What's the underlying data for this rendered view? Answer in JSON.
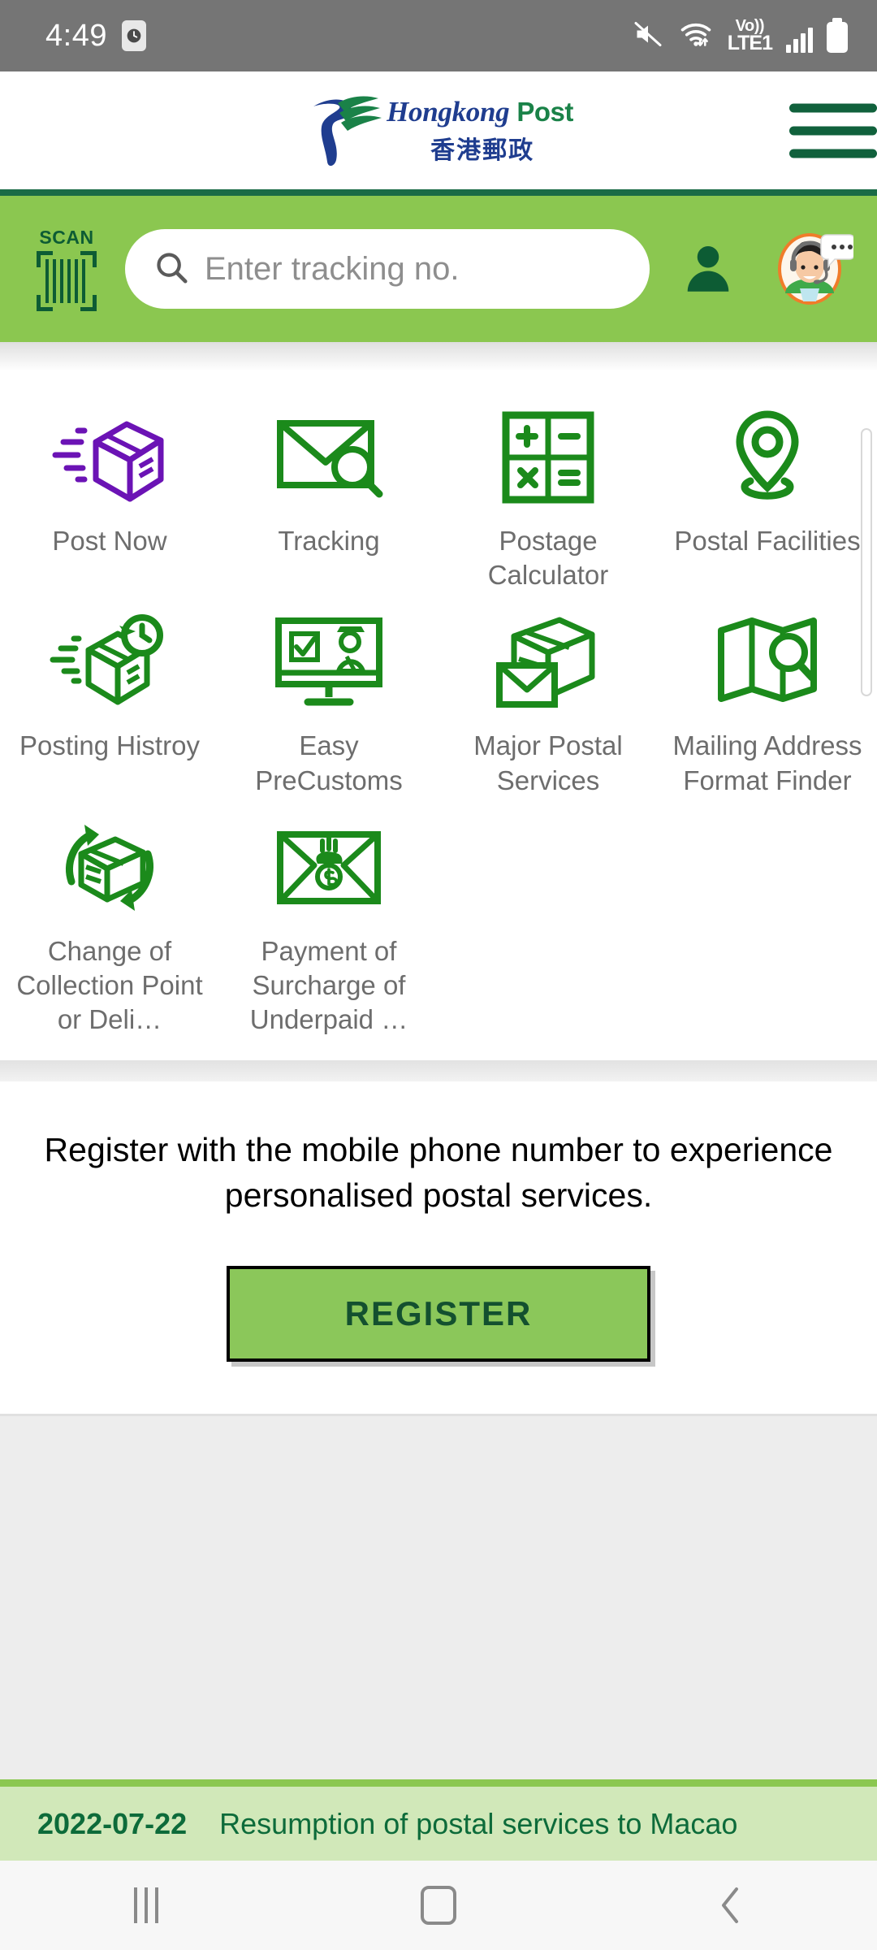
{
  "status_bar": {
    "time": "4:49",
    "clock_icon": "clock-icon",
    "icons": [
      "mute-icon",
      "wifi-icon",
      "volte-icon",
      "signal-icon",
      "battery-icon"
    ],
    "volte_top": "Vo))",
    "volte_bottom": "LTE1"
  },
  "header": {
    "logo_name_en": "Hongkong",
    "logo_name_post": "Post",
    "logo_name_zh": "香港郵政",
    "menu_icon": "hamburger-menu-icon"
  },
  "search": {
    "scan_label": "SCAN",
    "scan_icon": "barcode-scan-icon",
    "placeholder": "Enter tracking no.",
    "search_icon": "search-icon",
    "account_icon": "person-icon",
    "support_icon": "customer-service-avatar-icon"
  },
  "services": [
    {
      "label": "Post Now",
      "icon": "parcel-speed-icon",
      "color": "#6b13b5"
    },
    {
      "label": "Tracking",
      "icon": "envelope-search-icon",
      "color": "#1b8a1b"
    },
    {
      "label": "Postage Calculator",
      "icon": "calculator-icon",
      "color": "#1b8a1b"
    },
    {
      "label": "Postal Facilities",
      "icon": "location-pin-icon",
      "color": "#1b8a1b"
    },
    {
      "label": "Posting Histroy",
      "icon": "parcel-clock-icon",
      "color": "#1b8a1b"
    },
    {
      "label": "Easy PreCustoms",
      "icon": "monitor-customs-officer-icon",
      "color": "#1b8a1b"
    },
    {
      "label": "Major Postal Services",
      "icon": "parcel-envelope-icon",
      "color": "#1b8a1b"
    },
    {
      "label": "Mailing Address Format Finder",
      "icon": "map-search-icon",
      "color": "#1b8a1b"
    },
    {
      "label": "Change of Collection Point or Deli…",
      "icon": "parcel-refresh-icon",
      "color": "#1b8a1b"
    },
    {
      "label": "Payment of Surcharge of Underpaid …",
      "icon": "envelope-money-icon",
      "color": "#1b8a1b"
    }
  ],
  "register": {
    "message": "Register with the mobile phone number to experience personalised postal services.",
    "button_label": "REGISTER"
  },
  "news": {
    "date": "2022-07-22",
    "title": "Resumption of postal services to Macao"
  },
  "nav_bar": {
    "recents_icon": "recents-icon",
    "home_icon": "home-icon",
    "back_icon": "back-icon"
  },
  "colors": {
    "brand_green": "#1a8248",
    "brand_blue": "#1f3d8f",
    "band_green": "#8bc750",
    "news_bg": "#d1e8b9",
    "accent_purple": "#6b13b5"
  }
}
